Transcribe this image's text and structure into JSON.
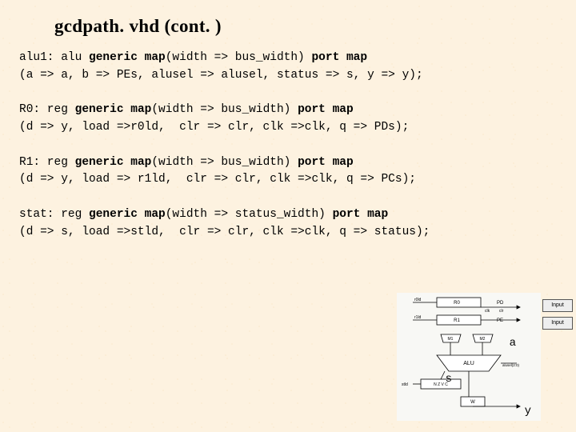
{
  "title": "gcdpath. vhd (cont. )",
  "code": {
    "block1": {
      "prefix": "alu1: alu ",
      "kw1": "generic map",
      "mid1": "(width => bus_width) ",
      "kw2": "port map",
      "line2": "(a => a, b => PEs, alusel => alusel, status => s, y => y);"
    },
    "block2": {
      "prefix": "R0: reg ",
      "kw1": "generic map",
      "mid1": "(width => bus_width) ",
      "kw2": "port map",
      "line2": "(d => y, load =>r0ld,  clr => clr, clk =>clk, q => PDs);"
    },
    "block3": {
      "prefix": "R1: reg ",
      "kw1": "generic map",
      "mid1": "(width => bus_width) ",
      "kw2": "port map",
      "line2": "(d => y, load => r1ld,  clr => clr, clk =>clk, q => PCs);"
    },
    "block4": {
      "prefix": "stat: reg ",
      "kw1": "generic map",
      "mid1": "(width => status_width) ",
      "kw2": "port map",
      "line2": "(d => s, load =>stld,  clr => clr, clk =>clk, q => status);"
    }
  },
  "diagram": {
    "r0": "R0",
    "r1": "R1",
    "alu": "ALU",
    "pd": "PD",
    "pe": "PE",
    "m1": "M1",
    "m2": "M2",
    "w": "W",
    "nzvc": "N Z V C",
    "label_a": "a",
    "label_s": "s",
    "label_y": "y",
    "input1": "Input",
    "input2": "Input",
    "r0ld": "r0ld",
    "clk": "clk",
    "clr": "clr",
    "r1ld": "r1ld",
    "alusel": "alusel(2:0)",
    "stld": "stld"
  }
}
